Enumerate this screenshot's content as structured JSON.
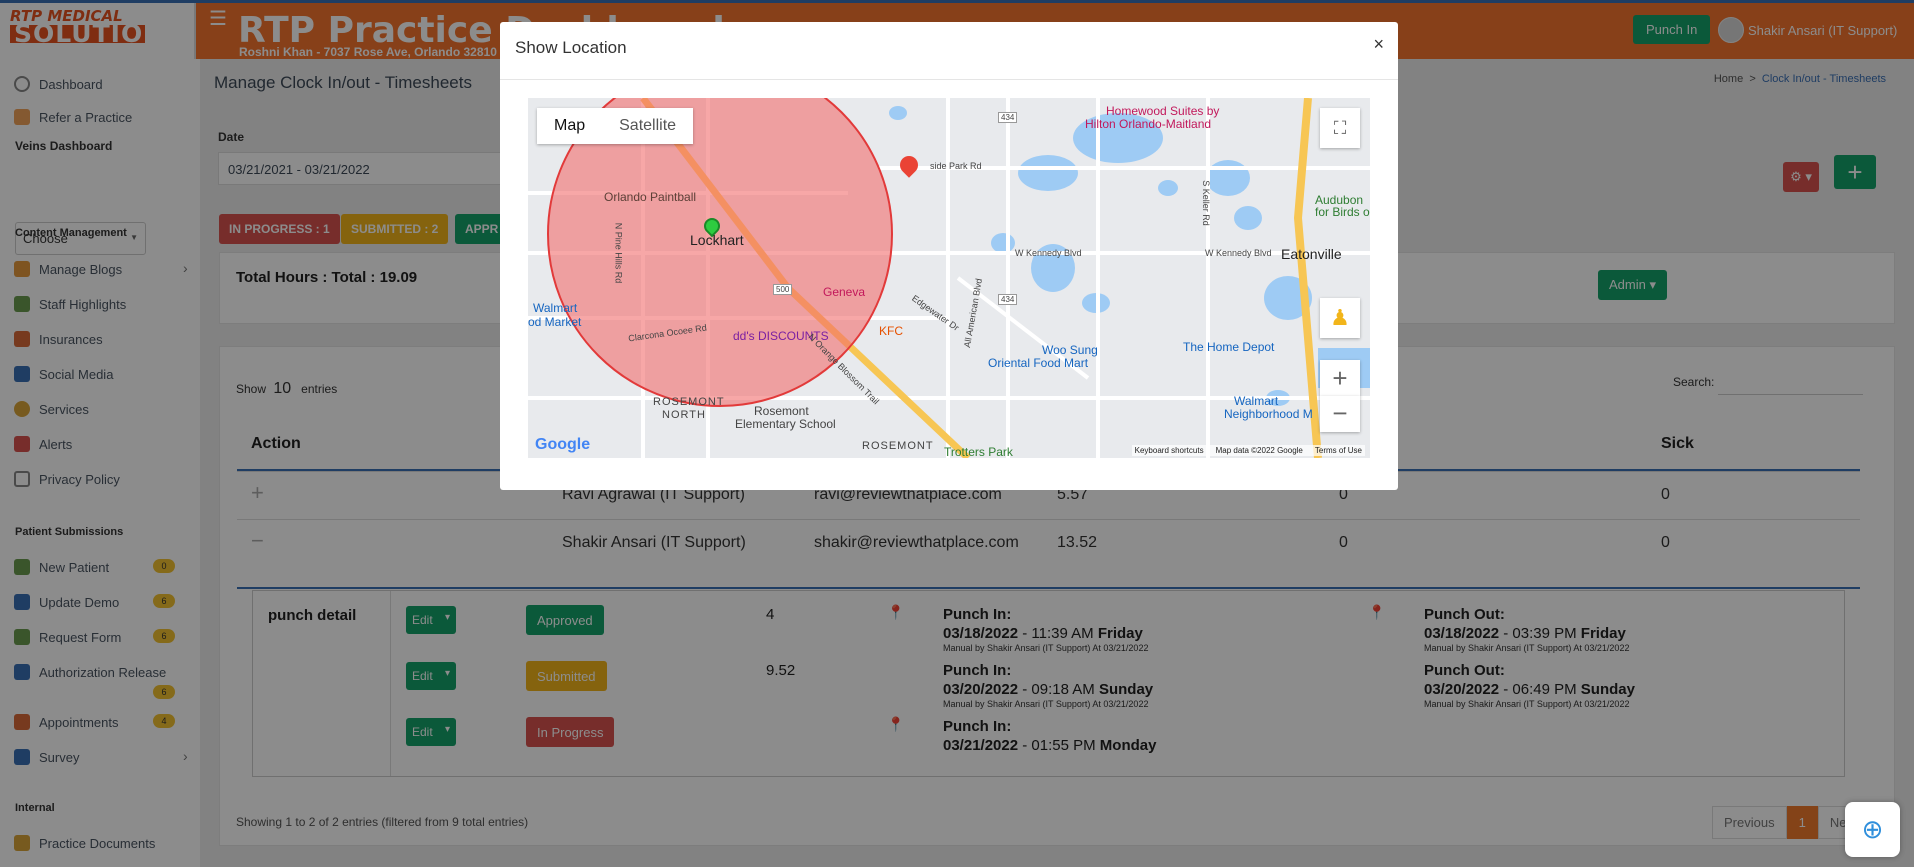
{
  "header": {
    "logo_line1": "RTP MEDICAL",
    "logo_line2": "SOLUTION",
    "menu_icon": "hamburger-icon",
    "title": "RTP Practice Dashboard",
    "subtitle": "Roshni Khan - 7037 Rose Ave, Orlando 32810",
    "punch_in": "Punch In",
    "user": "Shakir Ansari (IT Support)"
  },
  "sidebar": {
    "dashboard": "Dashboard",
    "refer": "Refer a Practice",
    "veins": "Veins Dashboard",
    "choose": "Choose",
    "content_head": "Content Management",
    "manage_blogs": "Manage Blogs",
    "staff": "Staff Highlights",
    "insurances": "Insurances",
    "social": "Social Media",
    "services": "Services",
    "alerts": "Alerts",
    "privacy": "Privacy Policy",
    "patient_head": "Patient Submissions",
    "new_patient": "New Patient",
    "new_patient_badge": "0",
    "update_demo": "Update Demo",
    "update_demo_badge": "6",
    "request_form": "Request Form",
    "request_form_badge": "6",
    "auth_release": "Authorization Release",
    "auth_release_badge": "6",
    "appointments": "Appointments",
    "appointments_badge": "4",
    "survey": "Survey",
    "internal_head": "Internal",
    "practice_docs": "Practice Documents"
  },
  "main": {
    "page_title": "Manage Clock In/out - Timesheets",
    "breadcrumb_home": "Home",
    "breadcrumb_sep": ">",
    "breadcrumb_current": "Clock In/out - Timesheets",
    "date_label": "Date",
    "date_value": "03/21/2021 - 03/21/2022",
    "status_inprogress": "IN PROGRESS : 1",
    "status_submitted": "SUBMITTED : 2",
    "status_approved": "APPR",
    "total": "Total Hours : Total : 19.09",
    "admin": "Admin",
    "show_label": "Show",
    "show_count": "10",
    "entries": "entries",
    "search_label": "Search:",
    "columns": {
      "action": "Action",
      "sick": "Sick"
    },
    "rows": [
      {
        "toggle": "+",
        "name": "Ravi Agrawal (IT Support)",
        "email": "ravi@reviewthatplace.com",
        "hours": "5.57",
        "col5": "0",
        "sick": "0"
      },
      {
        "toggle": "−",
        "name": "Shakir Ansari (IT Support)",
        "email": "shakir@reviewthatplace.com",
        "hours": "13.52",
        "col5": "0",
        "sick": "0"
      }
    ],
    "punch_detail": {
      "title": "punch detail",
      "edit": "Edit",
      "entries": [
        {
          "status": "Approved",
          "hours": "4",
          "in_label": "Punch In:",
          "in_date": "03/18/2022",
          "in_time": " - 11:39 AM ",
          "in_day": "Friday",
          "in_note": "Manual by Shakir Ansari (IT Support) At 03/21/2022",
          "out_label": "Punch Out:",
          "out_date": "03/18/2022",
          "out_time": " - 03:39 PM ",
          "out_day": "Friday",
          "out_note": "Manual by Shakir Ansari (IT Support) At 03/21/2022"
        },
        {
          "status": "Submitted",
          "hours": "9.52",
          "in_label": "Punch In:",
          "in_date": "03/20/2022",
          "in_time": " - 09:18 AM ",
          "in_day": "Sunday",
          "in_note": "Manual by Shakir Ansari (IT Support) At 03/21/2022",
          "out_label": "Punch Out:",
          "out_date": "03/20/2022",
          "out_time": " - 06:49 PM ",
          "out_day": "Sunday",
          "out_note": "Manual by Shakir Ansari (IT Support) At 03/21/2022"
        },
        {
          "status": "In Progress",
          "hours": "",
          "in_label": "Punch In:",
          "in_date": "03/21/2022",
          "in_time": " - 01:55 PM ",
          "in_day": "Monday",
          "in_note": ""
        }
      ]
    },
    "showing": "Showing 1 to 2 of 2 entries (filtered from 9 total entries)",
    "pager": {
      "prev": "Previous",
      "page": "1",
      "next": "Nex"
    }
  },
  "modal": {
    "title": "Show Location",
    "close": "×",
    "map_tab": "Map",
    "satellite_tab": "Satellite",
    "zoom_in": "+",
    "zoom_out": "−",
    "google": "Google",
    "attr_keys": "Keyboard shortcuts",
    "attr_data": "Map data ©2022 Google",
    "attr_terms": "Terms of Use",
    "labels": {
      "homewood": "Homewood Suites by",
      "homewood2": "Hilton Orlando-Maitland",
      "orlando_paintball": "Orlando Paintball",
      "lockhart": "Lockhart",
      "geneva": "Geneva",
      "dds": "dd's DISCOUNTS",
      "kfc": "KFC",
      "walmart": "Walmart",
      "walmart2": "od Market",
      "clarcona": "Clarcona Ocoee Rd",
      "rosemont_north": "ROSEMONT",
      "rosemont_north2": "NORTH",
      "rosemont_es": "Rosemont",
      "rosemont_es2": "Elementary School",
      "rosemont": "ROSEMONT",
      "trotters": "Trotters Park",
      "woo_sung": "Woo Sung",
      "woo_sung2": "Oriental Food Mart",
      "home_depot": "The Home Depot",
      "walmart_n": "Walmart",
      "walmart_n2": "Neighborhood M",
      "eatonville": "Eatonville",
      "audubon": "Audubon",
      "audubon2": "for Birds o",
      "w_kennedy": "W Kennedy Blvd",
      "w_kennedy2": "W Kennedy Blvd",
      "pine_hills": "N Pine Hills Rd",
      "all_american": "All American Blvd",
      "edgewater": "Edgewater Dr",
      "orange_blossom": "N Orange Blossom Trail",
      "lake_park": "side Park Rd",
      "keller": "S Keller Rd",
      "r434": "434",
      "r434b": "434",
      "r500": "500"
    }
  }
}
